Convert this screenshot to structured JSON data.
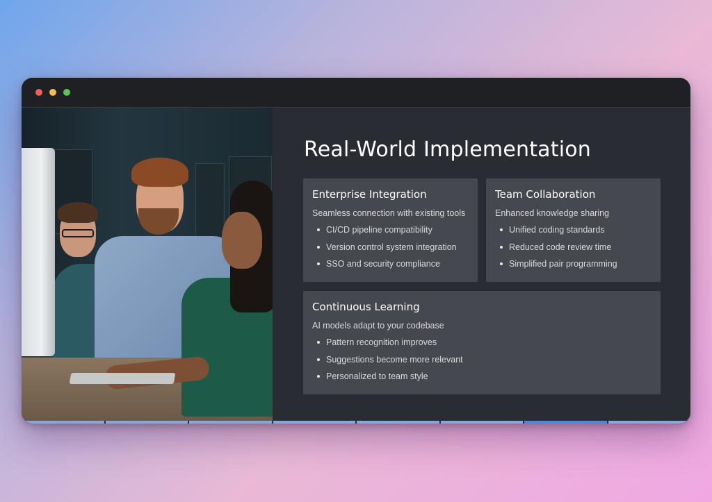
{
  "window": {
    "controls": [
      "close",
      "minimize",
      "maximize"
    ]
  },
  "photo": {
    "description_icon": "team-photo"
  },
  "slide": {
    "title": "Real-World Implementation",
    "cards": [
      {
        "title": "Enterprise Integration",
        "subtitle": "Seamless connection with existing tools",
        "items": [
          "CI/CD pipeline compatibility",
          "Version control system integration",
          "SSO and security compliance"
        ]
      },
      {
        "title": "Team Collaboration",
        "subtitle": "Enhanced knowledge sharing",
        "items": [
          "Unified coding standards",
          "Reduced code review time",
          "Simplified pair programming"
        ]
      },
      {
        "title": "Continuous Learning",
        "subtitle": "AI models adapt to your codebase",
        "items": [
          "Pattern recognition improves",
          "Suggestions become more relevant",
          "Personalized to team style"
        ]
      }
    ]
  },
  "progress": {
    "total_segments": 8,
    "current_segment": 7
  },
  "colors": {
    "window_bg": "#2a2c33",
    "card_bg": "#46484f",
    "progress_done": "#8aa6d6",
    "progress_current": "#4e86d8"
  }
}
